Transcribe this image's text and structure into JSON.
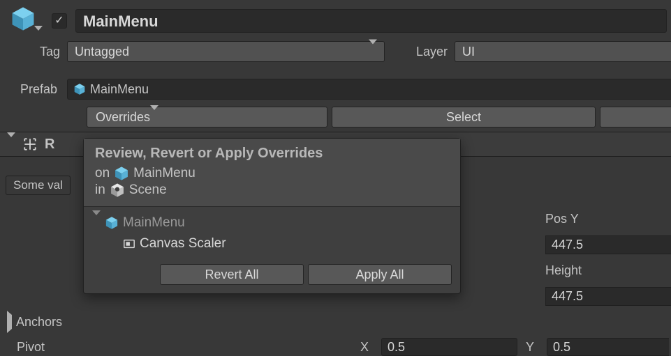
{
  "header": {
    "nameValue": "MainMenu",
    "active": true
  },
  "tag": {
    "label": "Tag",
    "value": "Untagged"
  },
  "layer": {
    "label": "Layer",
    "value": "UI"
  },
  "prefab": {
    "label": "Prefab",
    "name": "MainMenu",
    "overridesLabel": "Overrides",
    "selectLabel": "Select"
  },
  "component": {
    "title": "R",
    "someValues": "Some val"
  },
  "transform": {
    "posYLabel": "Pos Y",
    "posYValue": "447.5",
    "heightLabel": "Height",
    "heightValue": "447.5"
  },
  "anchors": {
    "label": "Anchors"
  },
  "pivot": {
    "label": "Pivot",
    "xLabel": "X",
    "xValue": "0.5",
    "yLabel": "Y",
    "yValue": "0.5"
  },
  "popup": {
    "title": "Review, Revert or Apply Overrides",
    "onLabel": "on",
    "onTarget": "MainMenu",
    "inLabel": "in",
    "inTarget": "Scene",
    "treeRoot": "MainMenu",
    "treeChild": "Canvas Scaler",
    "revertAll": "Revert All",
    "applyAll": "Apply All"
  },
  "icons": {
    "prefabCubeColor": "#6ec4e8",
    "unityGrey": "#c9c9c9"
  }
}
